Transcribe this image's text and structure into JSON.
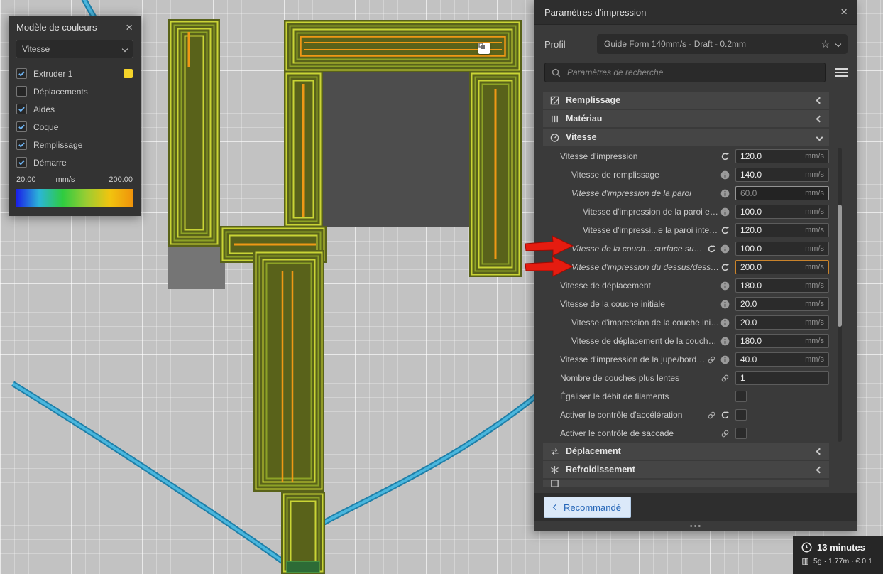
{
  "icons": {
    "close": "×",
    "star": "☆"
  },
  "colors": {
    "accent_blue": "#2566b8",
    "highlight_orange": "#c9832b",
    "annotation_red": "#e51c10",
    "legend_gradient": [
      "#1a1ae8",
      "#2bb5d8",
      "#2ecc40",
      "#9acd32",
      "#f1c40f",
      "#f0920b"
    ]
  },
  "color_scheme_panel": {
    "title": "Modèle de couleurs",
    "dropdown_value": "Vitesse",
    "items": [
      {
        "label": "Extruder 1",
        "checked": true,
        "swatch": "#f5d42a"
      },
      {
        "label": "Déplacements",
        "checked": false
      },
      {
        "label": "Aides",
        "checked": true
      },
      {
        "label": "Coque",
        "checked": true
      },
      {
        "label": "Remplissage",
        "checked": true
      },
      {
        "label": "Démarre",
        "checked": true
      }
    ],
    "legend_min": "20.00",
    "legend_unit": "mm/s",
    "legend_max": "200.00"
  },
  "print_settings": {
    "title": "Paramètres d'impression",
    "profile_label": "Profil",
    "profile_value": "Guide Form 140mm/s - Draft - 0.2mm",
    "search_placeholder": "Paramètres de recherche",
    "categories": {
      "remplissage": "Remplissage",
      "materiau": "Matériau",
      "vitesse": "Vitesse",
      "deplacement": "Déplacement",
      "refroidissement": "Refroidissement"
    },
    "rows": [
      {
        "label": "Vitesse d'impression",
        "indent": 0,
        "italic": false,
        "icons": [
          "revert"
        ],
        "control": "input",
        "value": "120.0",
        "unit": "mm/s",
        "style": "normal"
      },
      {
        "label": "Vitesse de remplissage",
        "indent": 1,
        "italic": false,
        "icons": [
          "info"
        ],
        "control": "input",
        "value": "140.0",
        "unit": "mm/s",
        "style": "normal"
      },
      {
        "label": "Vitesse d'impression de la paroi",
        "indent": 1,
        "italic": true,
        "icons": [
          "info"
        ],
        "control": "input",
        "value": "60.0",
        "unit": "mm/s",
        "style": "dimmed"
      },
      {
        "label": "Vitesse d'impression de la paroi externe",
        "indent": 2,
        "italic": false,
        "icons": [
          "info"
        ],
        "control": "input",
        "value": "100.0",
        "unit": "mm/s",
        "style": "normal"
      },
      {
        "label": "Vitesse d'impressi...e la paroi interne",
        "indent": 2,
        "italic": false,
        "icons": [
          "revert"
        ],
        "control": "input",
        "value": "120.0",
        "unit": "mm/s",
        "style": "normal"
      },
      {
        "label": "Vitesse de la couch... surface supérieure",
        "indent": 1,
        "italic": true,
        "icons": [
          "revert",
          "info"
        ],
        "control": "input",
        "value": "100.0",
        "unit": "mm/s",
        "style": "normal"
      },
      {
        "label": "Vitesse d'impression du dessus/dessous",
        "indent": 1,
        "italic": true,
        "icons": [
          "revert"
        ],
        "control": "input",
        "value": "200.0",
        "unit": "mm/s",
        "style": "highlight"
      },
      {
        "label": "Vitesse de déplacement",
        "indent": 0,
        "italic": false,
        "icons": [
          "info"
        ],
        "control": "input",
        "value": "180.0",
        "unit": "mm/s",
        "style": "normal"
      },
      {
        "label": "Vitesse de la couche initiale",
        "indent": 0,
        "italic": false,
        "icons": [
          "info"
        ],
        "control": "input",
        "value": "20.0",
        "unit": "mm/s",
        "style": "normal"
      },
      {
        "label": "Vitesse d'impression de la couche initiale",
        "indent": 1,
        "italic": false,
        "icons": [
          "info"
        ],
        "control": "input",
        "value": "20.0",
        "unit": "mm/s",
        "style": "normal"
      },
      {
        "label": "Vitesse de déplacement de la couche initiale",
        "indent": 1,
        "italic": false,
        "icons": [
          "info"
        ],
        "control": "input",
        "value": "180.0",
        "unit": "mm/s",
        "style": "normal"
      },
      {
        "label": "Vitesse d'impression de la jupe/bordure",
        "indent": 0,
        "italic": false,
        "icons": [
          "link",
          "info"
        ],
        "control": "input",
        "value": "40.0",
        "unit": "mm/s",
        "style": "normal"
      },
      {
        "label": "Nombre de couches plus lentes",
        "indent": 0,
        "italic": false,
        "icons": [
          "link"
        ],
        "control": "input",
        "value": "1",
        "unit": "",
        "style": "normal"
      },
      {
        "label": "Égaliser le débit de filaments",
        "indent": 0,
        "italic": false,
        "icons": [],
        "control": "checkbox",
        "checked": false
      },
      {
        "label": "Activer le contrôle d'accélération",
        "indent": 0,
        "italic": false,
        "icons": [
          "link",
          "revert"
        ],
        "control": "checkbox",
        "checked": false
      },
      {
        "label": "Activer le contrôle de saccade",
        "indent": 0,
        "italic": false,
        "icons": [
          "link"
        ],
        "control": "checkbox",
        "checked": false
      }
    ],
    "back_button": "Recommandé",
    "resize_dots": "•••"
  },
  "job_info": {
    "time": "13 minutes",
    "material": "5g · 1.77m · € 0.1"
  }
}
